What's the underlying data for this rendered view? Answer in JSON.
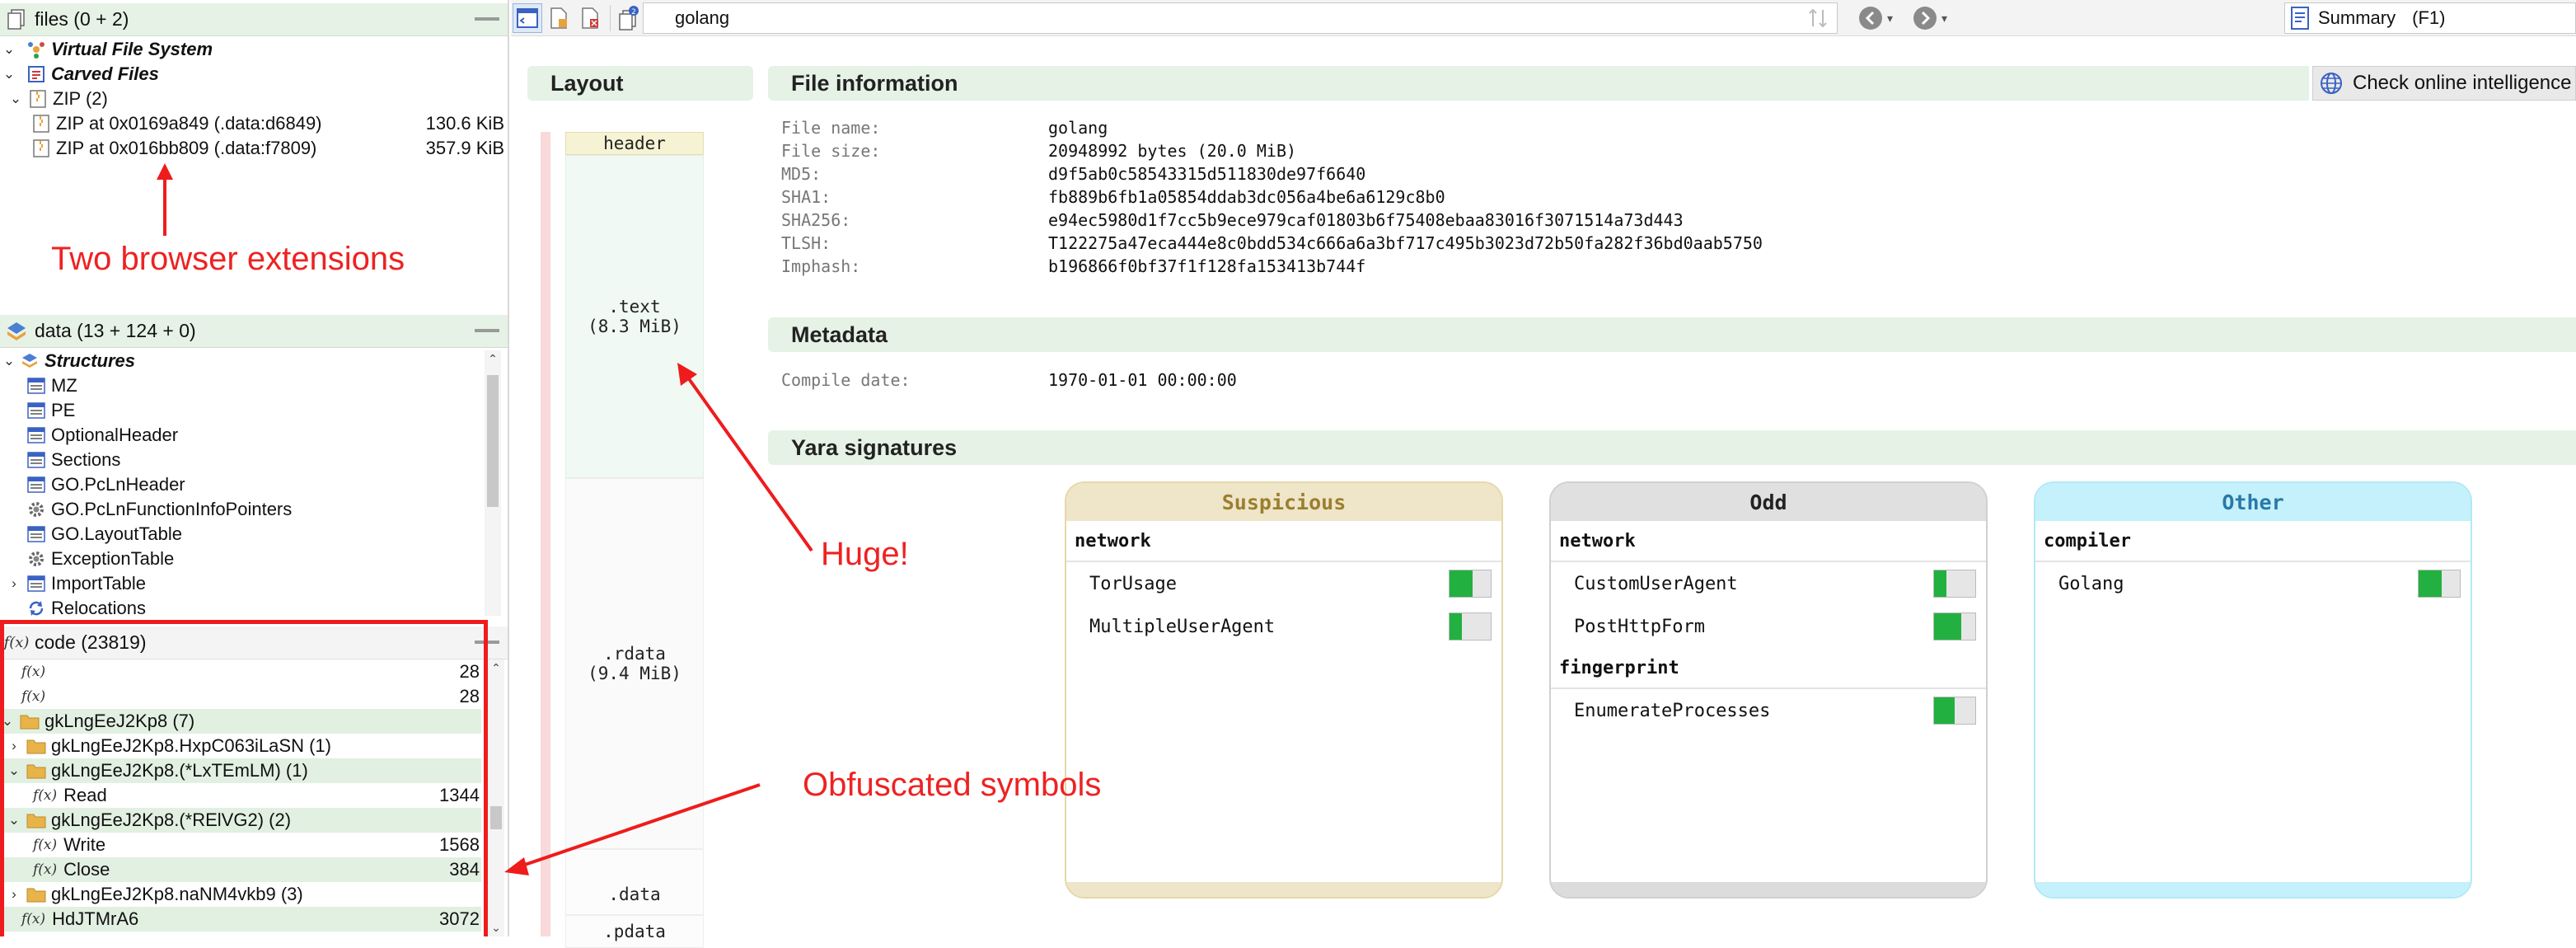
{
  "files_panel": {
    "title": "files (0 + 2)",
    "items": [
      {
        "label": "Virtual File System"
      },
      {
        "label": "Carved Files"
      },
      {
        "label": "ZIP (2)"
      },
      {
        "label": "ZIP at 0x0169a849 (.data:d6849)",
        "size": "130.6 KiB"
      },
      {
        "label": "ZIP at 0x016bb809 (.data:f7809)",
        "size": "357.9 KiB"
      }
    ]
  },
  "data_panel": {
    "title": "data (13 + 124 + 0)",
    "items": [
      {
        "label": "Structures"
      },
      {
        "label": "MZ"
      },
      {
        "label": "PE"
      },
      {
        "label": "OptionalHeader"
      },
      {
        "label": "Sections"
      },
      {
        "label": "GO.PcLnHeader"
      },
      {
        "label": "GO.PcLnFunctionInfoPointers"
      },
      {
        "label": "GO.LayoutTable"
      },
      {
        "label": "ExceptionTable"
      },
      {
        "label": "ImportTable"
      },
      {
        "label": "Relocations"
      }
    ]
  },
  "code_panel": {
    "title": "code (23819)",
    "items": [
      {
        "label": "",
        "size": "28"
      },
      {
        "label": "",
        "size": "28"
      },
      {
        "label": "gkLngEeJ2Kp8 (7)",
        "size": ""
      },
      {
        "label": "gkLngEeJ2Kp8.HxpC063iLaSN (1)",
        "size": ""
      },
      {
        "label": "gkLngEeJ2Kp8.(*LxTEmLM) (1)",
        "size": ""
      },
      {
        "label": "Read",
        "size": "1344"
      },
      {
        "label": "gkLngEeJ2Kp8.(*RElVG2) (2)",
        "size": ""
      },
      {
        "label": "Write",
        "size": "1568"
      },
      {
        "label": "Close",
        "size": "384"
      },
      {
        "label": "gkLngEeJ2Kp8.naNM4vkb9 (3)",
        "size": ""
      },
      {
        "label": "HdJTMrA6",
        "size": "3072"
      }
    ]
  },
  "toolbar": {
    "address": "golang",
    "view_select": "Summary",
    "view_shortcut": "(F1)"
  },
  "annotations": {
    "browser_extensions": "Two browser extensions",
    "huge": "Huge!",
    "obfuscated": "Obfuscated symbols"
  },
  "layout": {
    "title": "Layout",
    "segments": [
      {
        "label": "header"
      },
      {
        "label": ".text\n(8.3 MiB)"
      },
      {
        "label": ".rdata\n(9.4 MiB)"
      },
      {
        "label": ".data"
      },
      {
        "label": ".pdata"
      }
    ]
  },
  "file_info": {
    "title": "File information",
    "check_button": "Check online intelligence",
    "rows": [
      {
        "label": "File name:",
        "value": "golang"
      },
      {
        "label": "File size:",
        "value": "20948992 bytes (20.0 MiB)"
      },
      {
        "label": "MD5:",
        "value": "d9f5ab0c58543315d511830de97f6640"
      },
      {
        "label": "SHA1:",
        "value": "fb889b6fb1a05854ddab3dc056a4be6a6129c8b0"
      },
      {
        "label": "SHA256:",
        "value": "e94ec5980d1f7cc5b9ece979caf01803b6f75408ebaa83016f3071514a73d443"
      },
      {
        "label": "TLSH:",
        "value": "T122275a47eca444e8c0bdd534c666a6a3bf717c495b3023d72b50fa282f36bd0aab5750"
      },
      {
        "label": "Imphash:",
        "value": "b196866f0bf37f1f128fa153413b744f"
      }
    ]
  },
  "metadata": {
    "title": "Metadata",
    "rows": [
      {
        "label": "Compile date:",
        "value": "1970-01-01 00:00:00"
      }
    ]
  },
  "yara": {
    "title": "Yara signatures",
    "cards": [
      {
        "title": "Suspicious",
        "head_bg": "#efe5c8",
        "head_color": "#9a7f2f",
        "border": "#e6d8a9",
        "foot_bg": "#efe5c8",
        "groups": [
          {
            "name": "network",
            "items": [
              {
                "name": "TorUsage",
                "level": 0.55
              },
              {
                "name": "MultipleUserAgent",
                "level": 0.3
              }
            ]
          }
        ]
      },
      {
        "title": "Odd",
        "head_bg": "#e0e0e0",
        "head_color": "#222222",
        "border": "#d0d0d0",
        "foot_bg": "#dcdcdc",
        "groups": [
          {
            "name": "network",
            "items": [
              {
                "name": "CustomUserAgent",
                "level": 0.3
              },
              {
                "name": "PostHttpForm",
                "level": 0.65
              }
            ]
          },
          {
            "name": "fingerprint",
            "items": [
              {
                "name": "EnumerateProcesses",
                "level": 0.5
              }
            ]
          }
        ]
      },
      {
        "title": "Other",
        "head_bg": "#c4f1fb",
        "head_color": "#2a78a8",
        "border": "#b2e9f6",
        "foot_bg": "#c4f1fb",
        "groups": [
          {
            "name": "compiler",
            "items": [
              {
                "name": "Golang",
                "level": 0.55
              }
            ]
          }
        ]
      }
    ]
  }
}
